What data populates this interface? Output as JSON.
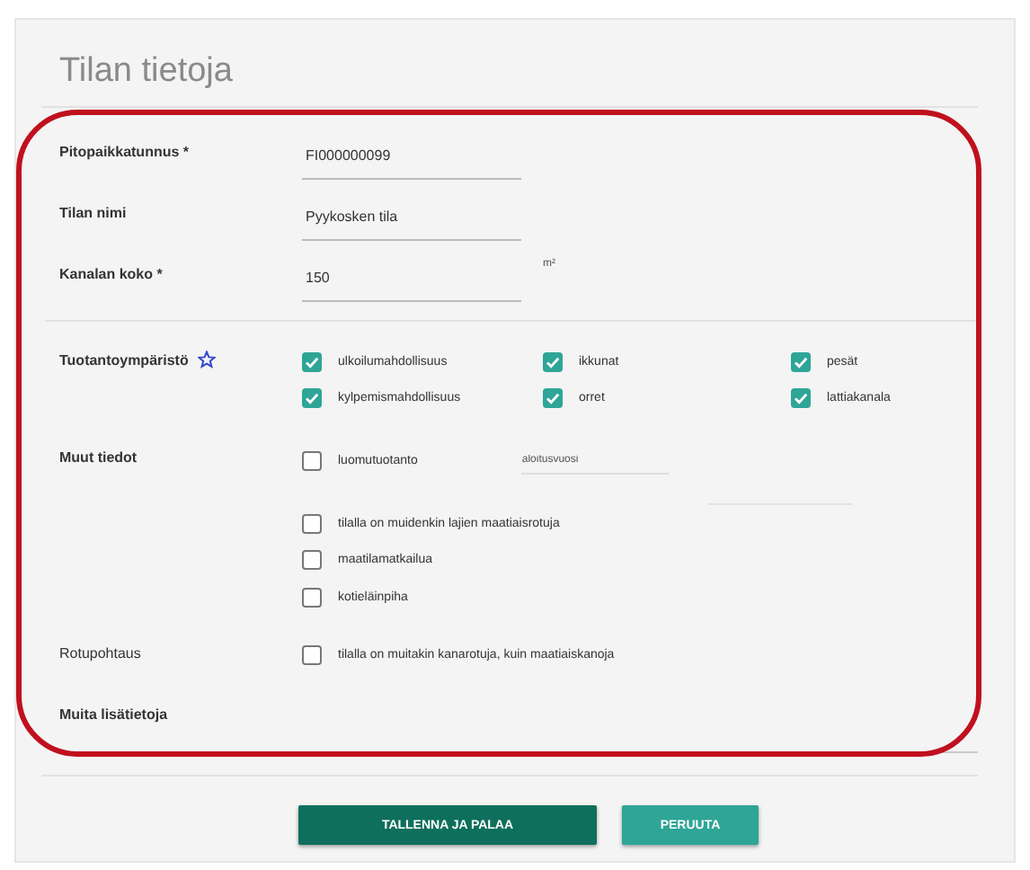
{
  "title": "Tilan tietoja",
  "fields": [
    {
      "label": "Pitopaikkatunnus *",
      "value": "FI000000099"
    },
    {
      "label": "Tilan nimi",
      "value": "Pyykosken tila"
    },
    {
      "label": "Kanalan koko *",
      "value": "150",
      "unit": "m²"
    }
  ],
  "production": {
    "label": "Tuotantoympäristö",
    "options": [
      {
        "label": "ulkoilumahdollisuus",
        "checked": true
      },
      {
        "label": "ikkunat",
        "checked": true
      },
      {
        "label": "pesät",
        "checked": true
      },
      {
        "label": "kylpemismahdollisuus",
        "checked": true
      },
      {
        "label": "orret",
        "checked": true
      },
      {
        "label": "lattiakanala",
        "checked": true
      }
    ]
  },
  "other": {
    "label": "Muut tiedot",
    "organic": {
      "label": "luomutuotanto",
      "checked": false
    },
    "start_year": {
      "placeholder": "aloitusvuosi"
    },
    "options": [
      {
        "label": "tilalla on muidenkin lajien maatiaisrotuja",
        "checked": false
      },
      {
        "label": "maatilamatkailua",
        "checked": false
      },
      {
        "label": "kotieläinpiha",
        "checked": false
      }
    ]
  },
  "breed": {
    "label": "Rotupohtaus",
    "options": [
      {
        "label": "tilalla on muitakin kanarotuja, kuin maatiaiskanoja",
        "checked": false
      }
    ]
  },
  "notes": {
    "label": "Muita lisätietoja"
  },
  "buttons": [
    {
      "label": "TALLENNA JA PALAA",
      "kind": "primary"
    },
    {
      "label": "PERUUTA",
      "kind": "secondary"
    }
  ]
}
